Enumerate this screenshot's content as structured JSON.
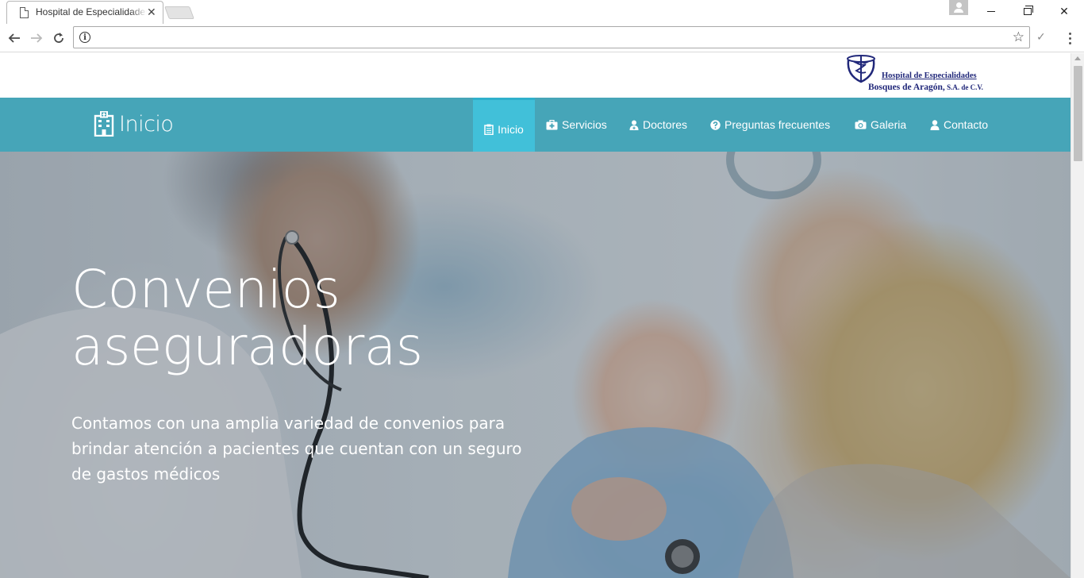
{
  "browser": {
    "tab_title": "Hospital de Especialidades Bosques de Aragón",
    "tab_close": "✕",
    "address": "",
    "back_icon": "arrow-left-icon",
    "forward_icon": "arrow-right-icon",
    "reload_icon": "reload-icon",
    "bookmark_icon": "star-icon",
    "window_minimize": "minimize-icon",
    "window_maximize": "restore-icon",
    "window_close": "✕"
  },
  "site": {
    "logo_line1": "Hospital de Especialidades",
    "logo_line2": "Bosques de Aragón,",
    "logo_line2_suffix": " S.A. de C.V.",
    "brand": "Inicio",
    "nav": [
      {
        "label": "Inicio",
        "icon": "clipboard-icon",
        "active": true
      },
      {
        "label": "Servicios",
        "icon": "medkit-icon",
        "active": false
      },
      {
        "label": "Doctores",
        "icon": "user-md-icon",
        "active": false
      },
      {
        "label": "Preguntas frecuentes",
        "icon": "question-circle-icon",
        "active": false
      },
      {
        "label": "Galeria",
        "icon": "camera-icon",
        "active": false
      },
      {
        "label": "Contacto",
        "icon": "user-icon",
        "active": false
      }
    ]
  },
  "hero": {
    "title": "Convenios aseguradoras",
    "description": "Contamos con una amplia variedad de convenios para brindar atención a pacientes que cuentan con un seguro de gastos médicos"
  },
  "colors": {
    "navbar": "#46a5b8",
    "nav_active": "#41c0d9",
    "logo_blue": "#21287a"
  }
}
